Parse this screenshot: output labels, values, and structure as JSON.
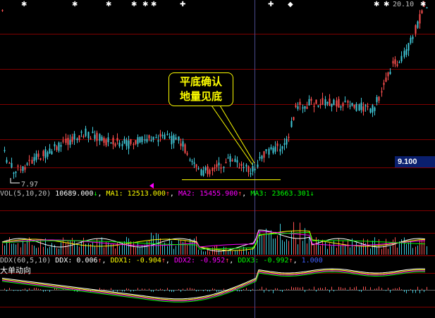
{
  "main_chart": {
    "top_price_label": "20.10",
    "low_price_label": "7.97",
    "current_price": "9.100",
    "annotation_line1": "平底确认",
    "annotation_line2": "地量见底"
  },
  "vol_indicator": {
    "name": "VOL(5,10,20)",
    "vol": "10689.000",
    "vol_arrow": "↓",
    "ma1_label": "MA1:",
    "ma1_value": "12513.000",
    "ma1_arrow": "↑",
    "ma2_label": "MA2:",
    "ma2_value": "15455.900",
    "ma2_arrow": "↑",
    "ma3_label": "MA3:",
    "ma3_value": "23663.301",
    "ma3_arrow": "↓"
  },
  "ddx_indicator": {
    "name": "DDX(60,5,10)",
    "ddx_label": "DDX:",
    "ddx_value": "0.006",
    "ddx_arrow": "↑",
    "ddx1_label": "DDX1:",
    "ddx1_value": "-0.904",
    "ddx1_arrow": "↑",
    "ddx2_label": "DDX2:",
    "ddx2_value": "-0.952",
    "ddx2_arrow": "↑",
    "ddx3_label": "DDX3:",
    "ddx3_value": "-0.992",
    "ddx3_arrow": "↑",
    "extra_value": "1.000",
    "subtitle": "大单动向"
  },
  "colors": {
    "background": "#000000",
    "up": "#ff5050",
    "down": "#40c8d8",
    "grid": "#800000",
    "ma1": "#ffffff",
    "ma2": "#ffff00",
    "ma3": "#ff00ff",
    "ma4": "#00ff00",
    "axis_text": "#c0c0c0"
  }
}
